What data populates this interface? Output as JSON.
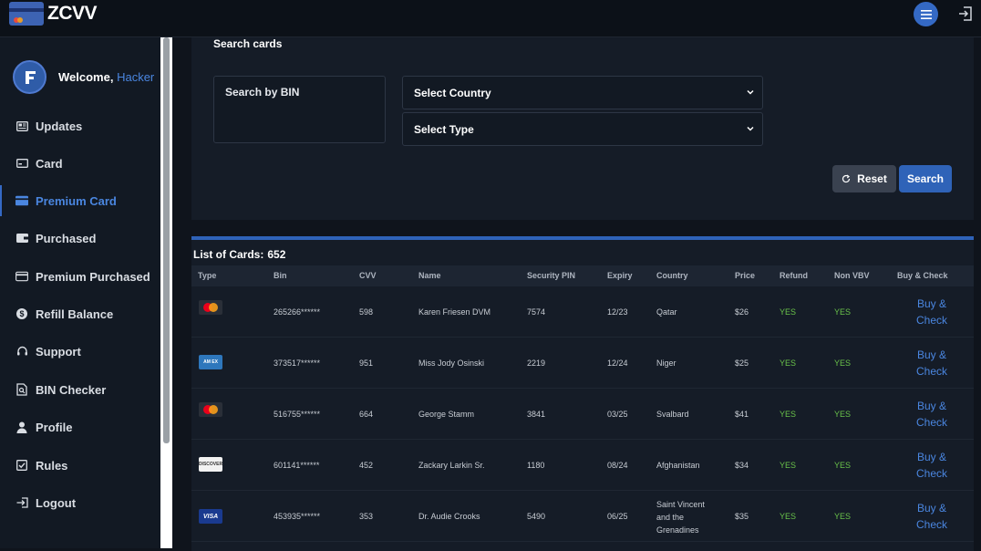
{
  "app": {
    "brand": "ZCVV",
    "accent": "#3469c4"
  },
  "user": {
    "welcome": "Welcome,",
    "name": "Hacker"
  },
  "nav": [
    {
      "label": "Updates",
      "icon": "news-icon"
    },
    {
      "label": "Card",
      "icon": "card-icon"
    },
    {
      "label": "Premium Card",
      "icon": "premium-card-icon",
      "active": true
    },
    {
      "label": "Purchased",
      "icon": "wallet-icon"
    },
    {
      "label": "Premium Purchased",
      "icon": "credit-card-icon"
    },
    {
      "label": "Refill Balance",
      "icon": "dollar-icon"
    },
    {
      "label": "Support",
      "icon": "headset-icon"
    },
    {
      "label": "BIN Checker",
      "icon": "file-search-icon"
    },
    {
      "label": "Profile",
      "icon": "person-icon"
    },
    {
      "label": "Rules",
      "icon": "checkbox-icon"
    },
    {
      "label": "Logout",
      "icon": "logout-icon"
    }
  ],
  "search": {
    "title": "Search cards",
    "bin_placeholder": "Search by BIN",
    "country_selected": "Select Country",
    "type_selected": "Select Type",
    "reset_label": "Reset",
    "search_label": "Search"
  },
  "list": {
    "title": "List of Cards:",
    "count": "652",
    "columns": [
      "Type",
      "Bin",
      "CVV",
      "Name",
      "Security PIN",
      "Expiry",
      "Country",
      "Price",
      "Refund",
      "Non VBV",
      "Buy & Check"
    ],
    "buy_line1": "Buy &",
    "buy_line2": "Check",
    "rows": [
      {
        "type": "mastercard",
        "bin": "265266******",
        "cvv": "598",
        "name": "Karen Friesen DVM",
        "pin": "7574",
        "expiry": "12/23",
        "country": "Qatar",
        "price": "$26",
        "refund": "YES",
        "nonvbv": "YES"
      },
      {
        "type": "amex",
        "bin": "373517******",
        "cvv": "951",
        "name": "Miss Jody Osinski",
        "pin": "2219",
        "expiry": "12/24",
        "country": "Niger",
        "price": "$25",
        "refund": "YES",
        "nonvbv": "YES"
      },
      {
        "type": "mastercard",
        "bin": "516755******",
        "cvv": "664",
        "name": "George Stamm",
        "pin": "3841",
        "expiry": "03/25",
        "country": "Svalbard",
        "price": "$41",
        "refund": "YES",
        "nonvbv": "YES"
      },
      {
        "type": "discover",
        "bin": "601141******",
        "cvv": "452",
        "name": "Zackary Larkin Sr.",
        "pin": "1180",
        "expiry": "08/24",
        "country": "Afghanistan",
        "price": "$34",
        "refund": "YES",
        "nonvbv": "YES"
      },
      {
        "type": "visa",
        "bin": "453935******",
        "cvv": "353",
        "name": "Dr. Audie Crooks",
        "pin": "5490",
        "expiry": "06/25",
        "country_lines": [
          "Saint Vincent",
          "and the",
          "Grenadines"
        ],
        "price": "$35",
        "refund": "YES",
        "nonvbv": "YES"
      }
    ],
    "card_logo_text": {
      "amex": "AM EX",
      "discover": "DISCOVER",
      "visa": "VISA"
    }
  }
}
